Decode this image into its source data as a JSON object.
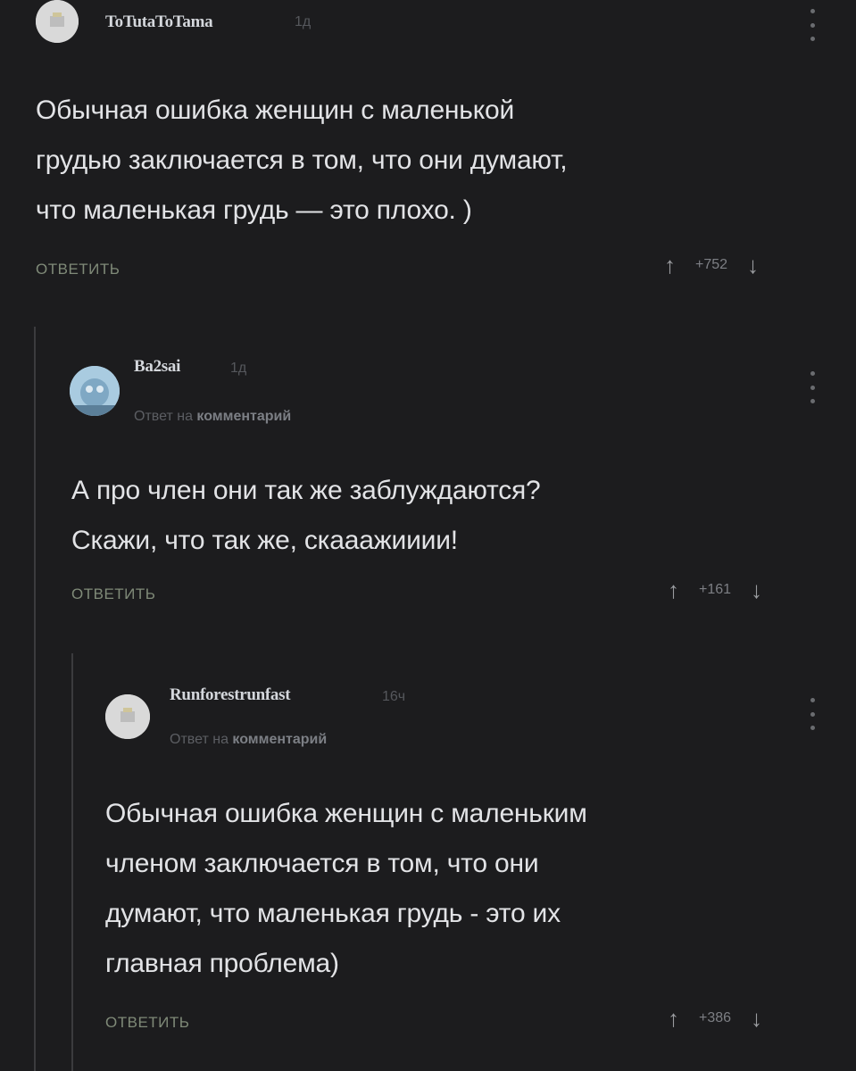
{
  "comments": [
    {
      "username": "ToTutaToTama",
      "time": "1д",
      "reply_note": null,
      "text_lines": [
        "Обычная ошибка женщин с маленькой",
        "грудью заключается в том, что они думают,",
        "что маленькая грудь — это плохо. )"
      ],
      "reply_label": "ОТВЕТИТЬ",
      "score": "+752"
    },
    {
      "username": "Ba2sai",
      "time": "1д",
      "reply_note": {
        "prefix": "Ответ на",
        "target": "комментарий"
      },
      "text_lines": [
        "А про член они так же заблуждаются?",
        "Скажи,  что так же, скааажииии!"
      ],
      "reply_label": "ОТВЕТИТЬ",
      "score": "+161"
    },
    {
      "username": "Runforestrunfast",
      "time": "16ч",
      "reply_note": {
        "prefix": "Ответ на",
        "target": "комментарий"
      },
      "text_lines": [
        "Обычная ошибка женщин с маленьким",
        "членом заключается в том, что они",
        "думают, что маленькая грудь - это их",
        "главная проблема)"
      ],
      "reply_label": "ОТВЕТИТЬ",
      "score": "+386"
    }
  ],
  "icons": {
    "upvote": "↑",
    "downvote": "↓"
  },
  "colors": {
    "background": "#1c1c1e",
    "reply_button": "#7f8a78",
    "text": "#e2e3e6"
  }
}
